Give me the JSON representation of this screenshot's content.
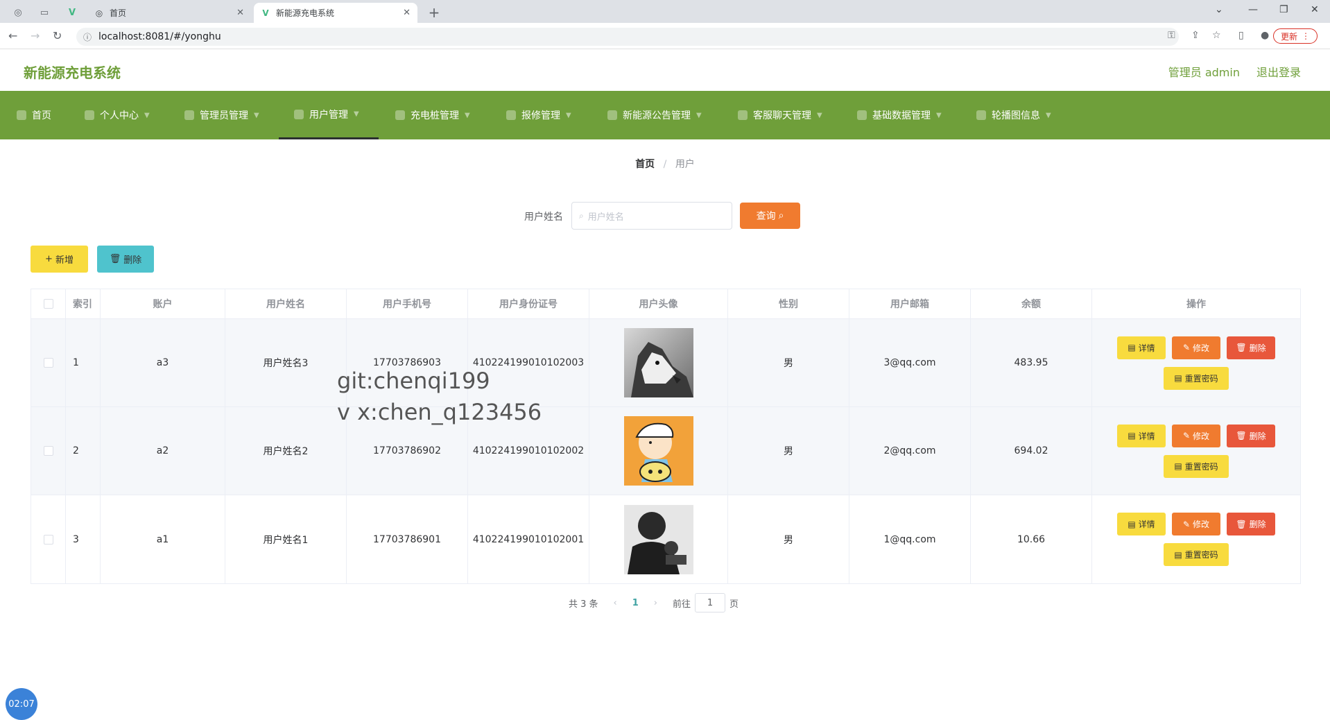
{
  "browser": {
    "tabs": [
      {
        "title": "首页"
      },
      {
        "title": "新能源充电系统"
      }
    ],
    "url": "localhost:8081/#/yonghu",
    "update_label": "更新"
  },
  "header": {
    "brand": "新能源充电系统",
    "admin_label": "管理员 admin",
    "logout_label": "退出登录"
  },
  "nav": {
    "items": [
      {
        "label": "首页"
      },
      {
        "label": "个人中心"
      },
      {
        "label": "管理员管理"
      },
      {
        "label": "用户管理"
      },
      {
        "label": "充电桩管理"
      },
      {
        "label": "报修管理"
      },
      {
        "label": "新能源公告管理"
      },
      {
        "label": "客服聊天管理"
      },
      {
        "label": "基础数据管理"
      },
      {
        "label": "轮播图信息"
      }
    ],
    "active_index": 3
  },
  "breadcrumb": {
    "home": "首页",
    "current": "用户"
  },
  "search": {
    "label": "用户姓名",
    "placeholder": "用户姓名",
    "button": "查询"
  },
  "actions": {
    "add": "新增",
    "delete": "删除"
  },
  "table": {
    "headers": [
      "索引",
      "账户",
      "用户姓名",
      "用户手机号",
      "用户身份证号",
      "用户头像",
      "性别",
      "用户邮箱",
      "余额",
      "操作"
    ],
    "rows": [
      {
        "index": "1",
        "account": "a3",
        "name": "用户姓名3",
        "phone": "17703786903",
        "id_card": "410224199010102003",
        "avatar": "husky-photo",
        "gender": "男",
        "email": "3@qq.com",
        "balance": "483.95"
      },
      {
        "index": "2",
        "account": "a2",
        "name": "用户姓名2",
        "phone": "17703786902",
        "id_card": "410224199010102002",
        "avatar": "cartoon-boy",
        "gender": "男",
        "email": "2@qq.com",
        "balance": "694.02"
      },
      {
        "index": "3",
        "account": "a1",
        "name": "用户姓名1",
        "phone": "17703786901",
        "id_card": "410224199010102001",
        "avatar": "man-silhouette",
        "gender": "男",
        "email": "1@qq.com",
        "balance": "10.66"
      }
    ],
    "row_actions": {
      "detail": "详情",
      "edit": "修改",
      "delete": "删除",
      "reset": "重置密码"
    }
  },
  "pagination": {
    "total": "共 3 条",
    "current_page": "1",
    "goto_label": "前往",
    "goto_value": "1",
    "page_suffix": "页"
  },
  "watermark": {
    "line1": "git:chenqi199",
    "line2": "v x:chen_q123456"
  },
  "clock": "02:07",
  "colors": {
    "brand_green": "#6f9f3a",
    "orange": "#f07b2f",
    "yellow": "#f8db3e",
    "teal": "#4fc3cd",
    "red": "#e8573b"
  }
}
